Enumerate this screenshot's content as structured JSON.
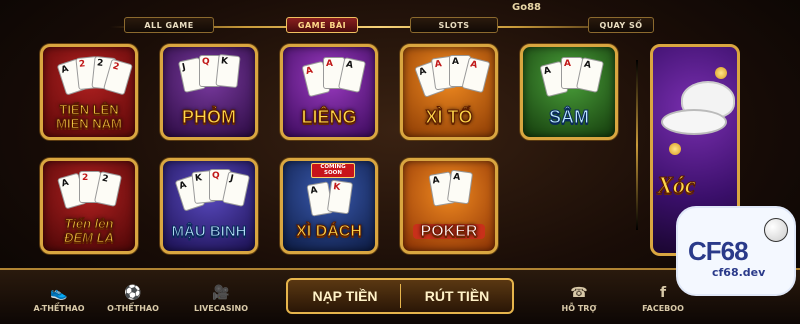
{
  "brand": "Go88",
  "tabs": [
    {
      "label": "ALL GAME",
      "active": false
    },
    {
      "label": "GAME BÀI",
      "active": true
    },
    {
      "label": "SLOTS",
      "active": false
    },
    {
      "label": "QUAY SỐ",
      "active": false
    }
  ],
  "games": [
    {
      "line1": "TIẾN LÊN",
      "line2": "MIỀN NAM",
      "bg": "#7a1010"
    },
    {
      "line1": "PHỎM",
      "line2": "",
      "bg": "#4a1f6e"
    },
    {
      "line1": "LIÊNG",
      "line2": "",
      "bg": "#6a1a8a"
    },
    {
      "line1": "XÌ TỐ",
      "line2": "",
      "bg": "#a03a08"
    },
    {
      "line1": "SÂM",
      "line2": "",
      "bg": "#2a6a1e"
    },
    {
      "line1": "Tiến lên",
      "line2": "ĐẾM LÁ",
      "bg": "#7a1010"
    },
    {
      "line1": "MẬU BINH",
      "line2": "",
      "bg": "#3a2a8a"
    },
    {
      "line1": "XÌ DÁCH",
      "line2": "",
      "bg": "#1a2a6a",
      "ribbon": "COMING SOON"
    },
    {
      "line1": "POKER",
      "line2": "",
      "bg": "#b0480a"
    }
  ],
  "feature_game": {
    "title": "Xóc"
  },
  "bottom_nav": {
    "left": [
      {
        "label": "A-THỂTHAO",
        "icon": "shoe-icon"
      },
      {
        "label": "O-THỂTHAO",
        "icon": "soccer-ball-icon"
      },
      {
        "label": "LIVECASINO",
        "icon": "camera-icon"
      }
    ],
    "center": {
      "deposit": "NẠP TIỀN",
      "withdraw": "RÚT TIỀN"
    },
    "right": [
      {
        "label": "HỖ TRỢ",
        "icon": "support-icon"
      },
      {
        "label": "FACEBOO",
        "icon": "facebook-icon"
      }
    ]
  },
  "watermark": {
    "name": "CF68",
    "url": "cf68.dev"
  }
}
